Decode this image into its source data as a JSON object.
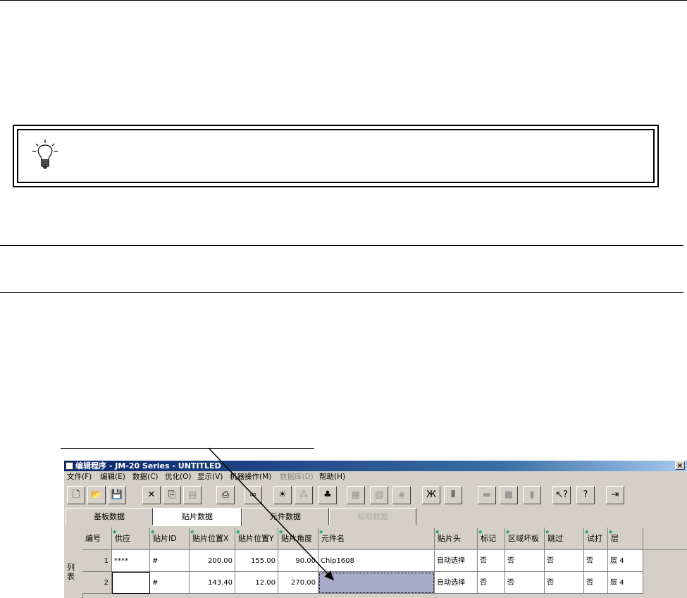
{
  "window": {
    "title": "编辑程序 - JM-20 Series - UNTITLED",
    "close_glyph": "×"
  },
  "menu": [
    {
      "label": "文件(F)",
      "enabled": true
    },
    {
      "label": "编辑(E)",
      "enabled": true
    },
    {
      "label": "数据(C)",
      "enabled": true
    },
    {
      "label": "优化(O)",
      "enabled": true
    },
    {
      "label": "显示(V)",
      "enabled": true
    },
    {
      "label": "机器操作(M)",
      "enabled": true
    },
    {
      "label": "数据库(D)",
      "enabled": false
    },
    {
      "label": "帮助(H)",
      "enabled": true
    }
  ],
  "toolbar": {
    "icons": [
      "new-file-icon",
      "open-folder-icon",
      "save-icon",
      "cut-icon",
      "copy-icon",
      "paste-icon",
      "print-icon",
      "find-icon",
      "bulb-icon",
      "tree-icon",
      "tricolor-icon",
      "import-icon",
      "grid-icon",
      "box-icon",
      "ruler-h-icon",
      "ruler-i-icon",
      "board-icon",
      "stop-icon",
      "stack-icon",
      "context-help-icon",
      "help-icon",
      "exit-icon"
    ]
  },
  "tabs": [
    {
      "label": "基板数据",
      "state": "normal"
    },
    {
      "label": "贴片数据",
      "state": "active"
    },
    {
      "label": "元件数据",
      "state": "normal"
    },
    {
      "label": "吸取数据",
      "state": "disabled"
    }
  ],
  "grid": {
    "side_label": "列表",
    "columns": [
      "编号",
      "供应",
      "贴片ID",
      "贴片位置X",
      "贴片位置Y",
      "贴片角度",
      "元件名",
      "贴片头",
      "标记",
      "区域坏板",
      "跳过",
      "试打",
      "层"
    ],
    "rows": [
      [
        "1",
        "****",
        "#",
        "200.00",
        "155.00",
        "90.00",
        "Chip1608",
        "自动选择",
        "否",
        "否",
        "否",
        "否",
        "层 4"
      ],
      [
        "2",
        "",
        "#",
        "143.40",
        "12.00",
        "270.00",
        "",
        "自动选择",
        "否",
        "否",
        "否",
        "否",
        "层 4"
      ]
    ]
  }
}
